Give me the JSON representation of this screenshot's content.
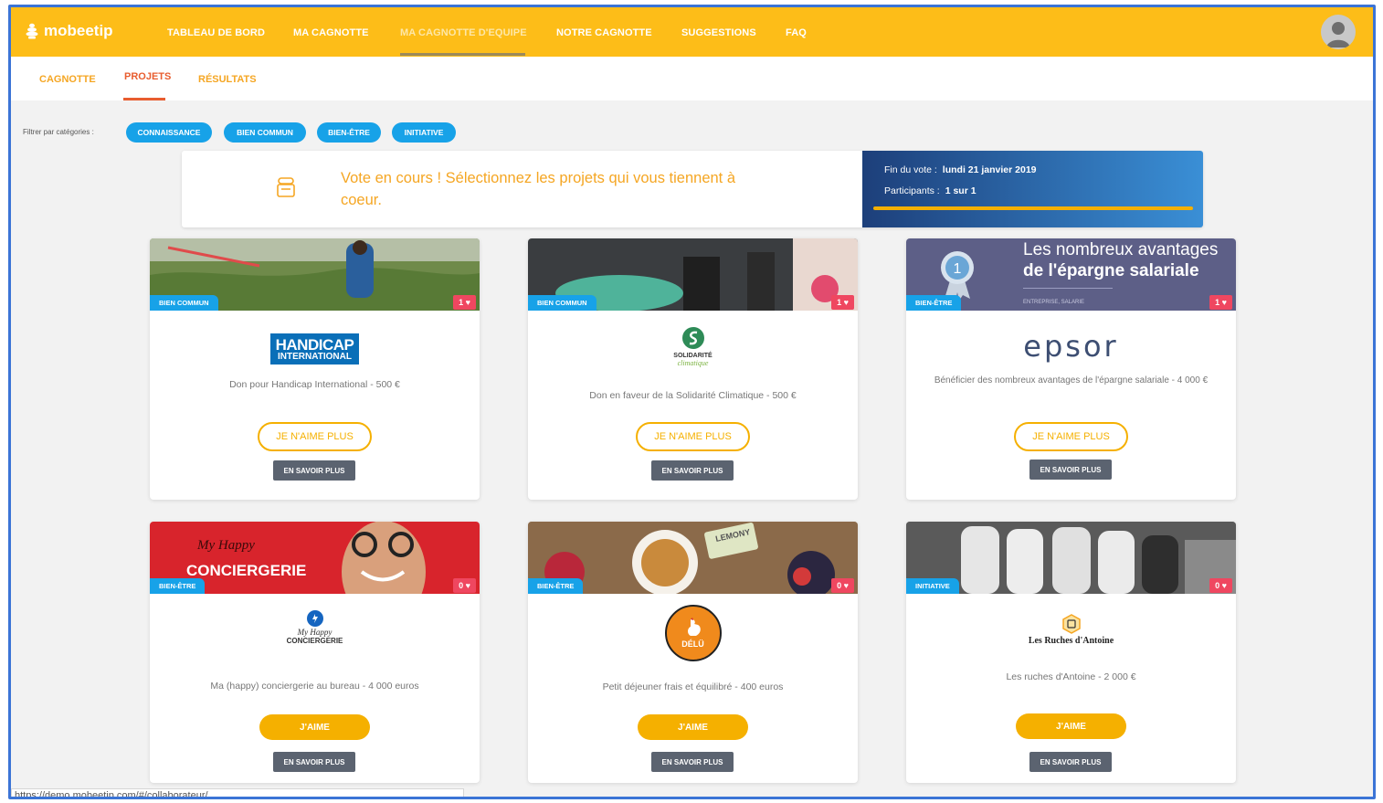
{
  "brand": {
    "name": "mobeetip",
    "accent": "#fdbd18",
    "blue": "#17a2e8"
  },
  "topnav": {
    "items": [
      {
        "label": "TABLEAU DE BORD"
      },
      {
        "label": "MA CAGNOTTE"
      },
      {
        "label": "MA CAGNOTTE D'EQUIPE",
        "active": true
      },
      {
        "label": "NOTRE CAGNOTTE"
      },
      {
        "label": "SUGGESTIONS"
      },
      {
        "label": "FAQ"
      }
    ]
  },
  "subnav": {
    "items": [
      {
        "label": "CAGNOTTE"
      },
      {
        "label": "PROJETS",
        "active": true
      },
      {
        "label": "RÉSULTATS"
      }
    ]
  },
  "filters": {
    "label": "Filtrer par catégories :",
    "chips": [
      "CONNAISSANCE",
      "BIEN COMMUN",
      "BIEN-ÊTRE",
      "INITIATIVE"
    ]
  },
  "banner": {
    "message": "Vote en cours ! Sélectionnez les projets qui vous tiennent à coeur.",
    "end_label": "Fin du vote :",
    "end_value": "lundi 21 janvier 2019",
    "participants_label": "Participants :",
    "participants_value": "1 sur 1",
    "progress": 1.0
  },
  "cards": [
    {
      "category": "BIEN COMMUN",
      "likes": "1 ♥",
      "logo_text": [
        "HANDICAP",
        "INTERNATIONAL"
      ],
      "description": "Don pour Handicap International - 500 €",
      "action": "JE N'AIME PLUS",
      "more": "EN SAVOIR PLUS"
    },
    {
      "category": "BIEN COMMUN",
      "likes": "1 ♥",
      "logo_text": [
        "SOLIDARITÉ",
        "climatique"
      ],
      "description": "Don en faveur de la Solidarité Climatique - 500 €",
      "action": "JE N'AIME PLUS",
      "more": "EN SAVOIR PLUS"
    },
    {
      "category": "BIEN-ÊTRE",
      "likes": "1 ♥",
      "image_text": [
        "Les nombreux avantages",
        "de l'épargne salariale",
        "ENTREPRISE, SALARIE"
      ],
      "logo_text": [
        "epsor"
      ],
      "description": "Bénéficier des nombreux avantages de l'épargne salariale - 4 000 €",
      "action": "JE N'AIME PLUS",
      "more": "EN SAVOIR PLUS"
    },
    {
      "category": "BIEN-ÊTRE",
      "likes": "0 ♥",
      "image_text": [
        "My Happy",
        "CONCIERGERIE"
      ],
      "logo_text": [
        "My Happy",
        "CONCIERGERIE"
      ],
      "description": "Ma (happy) conciergerie au bureau - 4 000 euros",
      "action": "J'AIME",
      "more": "EN SAVOIR PLUS"
    },
    {
      "category": "BIEN-ÊTRE",
      "likes": "0 ♥",
      "image_text": [
        "LEMONY"
      ],
      "logo_text": [
        "DÉLÜ"
      ],
      "description": "Petit déjeuner frais et équilibré - 400 euros",
      "action": "J'AIME",
      "more": "EN SAVOIR PLUS"
    },
    {
      "category": "INITIATIVE",
      "likes": "0 ♥",
      "logo_text": [
        "Les Ruches d'Antoine"
      ],
      "description": "Les ruches d'Antoine - 2 000 €",
      "action": "J'AIME",
      "more": "EN SAVOIR PLUS"
    }
  ],
  "statusbar": {
    "url": "https://demo.mobeetip.com/#/collaborateur/"
  }
}
